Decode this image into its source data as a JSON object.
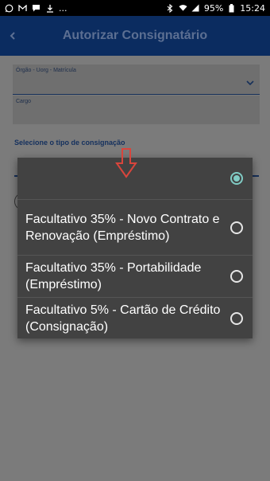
{
  "status_bar": {
    "ellipsis": "...",
    "battery": "95%",
    "time": "15:24"
  },
  "app_bar": {
    "title": "Autorizar Consignatário"
  },
  "form": {
    "field1_label": "Órgão - Uorg - Matrícula",
    "field2_label": "Cargo",
    "section_label": "Selecione o tipo de consignação"
  },
  "dialog": {
    "options": [
      {
        "label": "",
        "selected": true
      },
      {
        "label": "Facultativo 35% - Novo Contrato e Renovação (Empréstimo)",
        "selected": false
      },
      {
        "label": "Facultativo 35% - Portabilidade (Empréstimo)",
        "selected": false
      },
      {
        "label": "Facultativo 5% - Cartão de Crédito (Consignação)",
        "selected": false
      }
    ]
  },
  "colors": {
    "app_bar": "#0b2c60",
    "dialog_bg": "#424242",
    "accent": "#80cbc4",
    "annotation_arrow": "#d9453c"
  }
}
